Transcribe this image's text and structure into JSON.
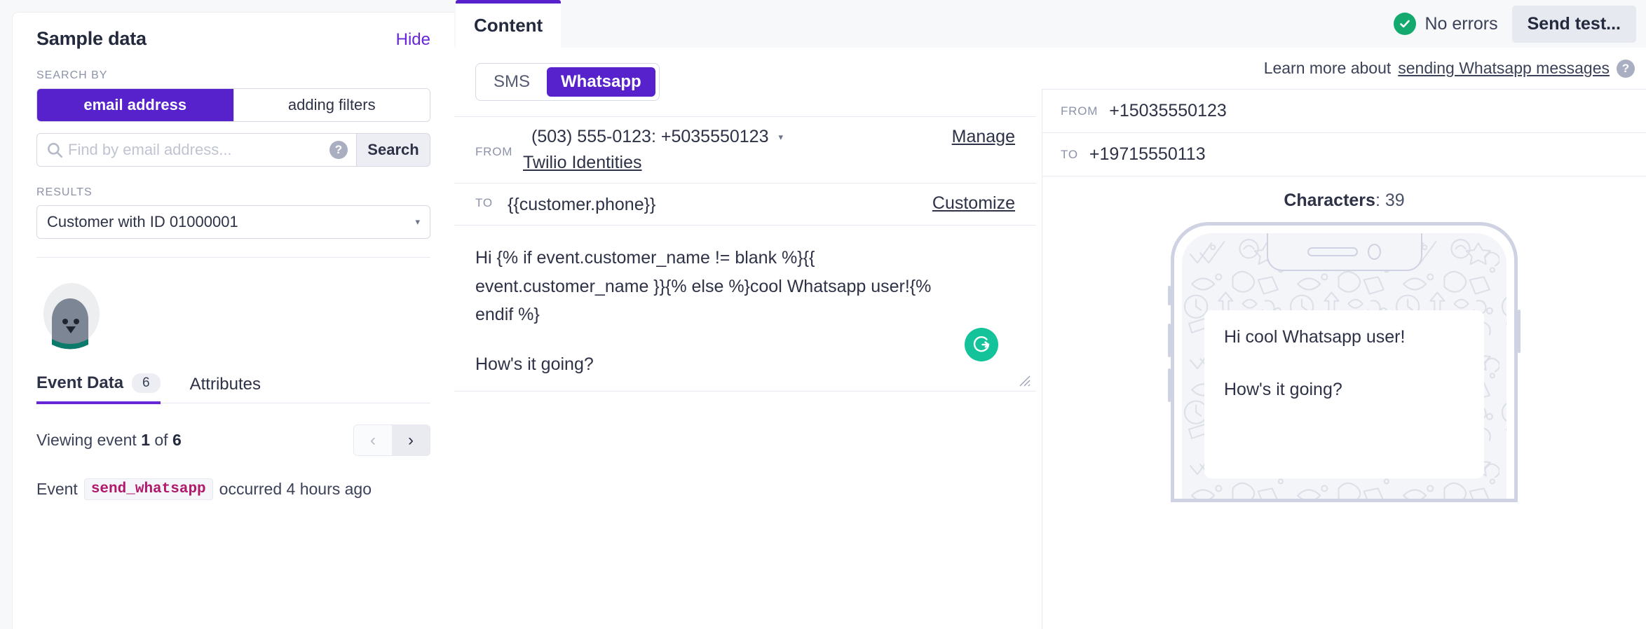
{
  "sidebar": {
    "title": "Sample data",
    "hide_label": "Hide",
    "search_by_label": "SEARCH BY",
    "segments": [
      {
        "label": "email address",
        "active": true
      },
      {
        "label": "adding filters",
        "active": false
      }
    ],
    "search_placeholder": "Find by email address...",
    "search_value": "",
    "search_button": "Search",
    "help_glyph": "?",
    "results_label": "RESULTS",
    "results_selected": "Customer with ID 01000001",
    "tabs": [
      {
        "label": "Event Data",
        "count": "6",
        "active": true
      },
      {
        "label": "Attributes",
        "count": "",
        "active": false
      }
    ],
    "viewing": {
      "prefix": "Viewing event",
      "current": "1",
      "middle": "of",
      "total": "6"
    },
    "pager": {
      "prev": "‹",
      "next": "›"
    },
    "event": {
      "prefix": "Event",
      "name": "send_whatsapp",
      "suffix": "occurred 4 hours ago"
    }
  },
  "center": {
    "tab_label": "Content",
    "channels": [
      {
        "label": "SMS",
        "active": false
      },
      {
        "label": "Whatsapp",
        "active": true
      }
    ],
    "from": {
      "key": "FROM",
      "number": "(503) 555-0123: +5035550123",
      "caret": "▾",
      "manage_label": "Manage",
      "identities_label": "Twilio Identities"
    },
    "to": {
      "key": "TO",
      "value": "{{customer.phone}}",
      "customize_label": "Customize"
    },
    "message_lines": [
      "Hi {% if event.customer_name != blank %}{{ event.customer_name }}{% else %}cool Whatsapp user!{% endif %}",
      "How's it going?"
    ],
    "grammarly_glyph": "G"
  },
  "topbar": {
    "status_text": "No errors",
    "status_color": "#13a96f",
    "send_test_label": "Send test..."
  },
  "preview": {
    "learn_prefix": "Learn more about",
    "learn_link": "sending Whatsapp messages",
    "help_glyph": "?",
    "from_key": "FROM",
    "from_value": "+15035550123",
    "to_key": "TO",
    "to_value": "+19715550113",
    "characters_label": "Characters",
    "characters_count": "39",
    "bubble_lines": [
      "Hi cool Whatsapp user!",
      "How's it going?"
    ]
  },
  "theme": {
    "purple": "#5721cc",
    "purple_link": "#6926d7",
    "green": "#13a96f",
    "grammarly_green": "#15c39a",
    "code_pink": "#b0186b"
  }
}
